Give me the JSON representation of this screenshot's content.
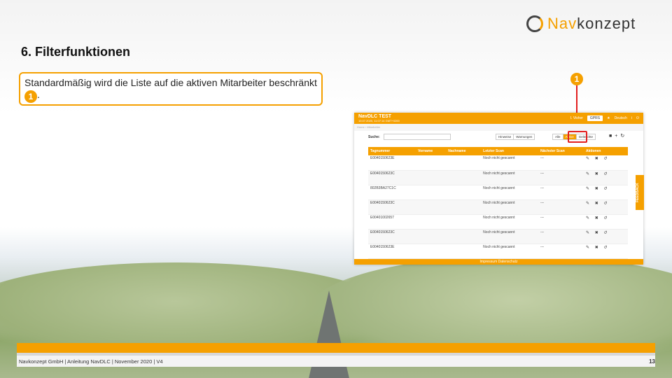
{
  "logo": {
    "part1": "Nav",
    "part2": "konzept"
  },
  "slide": {
    "title": "6. Filterfunktionen",
    "callout_text": "Standardmäßig wird die Liste auf die aktiven Mitarbeiter beschränkt",
    "callout_suffix": ".",
    "badge": "1"
  },
  "app": {
    "name": "NavDLC TEST",
    "timestamp": "10.07.2020, 11:07:14 GMT+0200",
    "user": "I. Visher",
    "gprs": "GPRS",
    "language": "Deutsch",
    "breadcrumb": "Home › Mitarbeiter",
    "search_label": "Suche:",
    "hint_buttons": [
      "Hinweise",
      "Warnungen"
    ],
    "filter_buttons": [
      "Alle",
      "Aktive",
      "Gelöschte"
    ],
    "columns": [
      "Tagnummer",
      "Vorname",
      "Nachname",
      "Letzter Scan",
      "Nächster Scan",
      "Aktionen"
    ],
    "rows": [
      {
        "tag": "E0040150623E",
        "scan": "Noch nicht gescannt",
        "next": "---"
      },
      {
        "tag": "E0040150623C",
        "scan": "Noch nicht gescannt",
        "next": "---"
      },
      {
        "tag": "802B3BA27C1C",
        "scan": "Noch nicht gescannt",
        "next": "---"
      },
      {
        "tag": "E0040150623C",
        "scan": "Noch nicht gescannt",
        "next": "---"
      },
      {
        "tag": "E00401002657",
        "scan": "Noch nicht gescannt",
        "next": "---"
      },
      {
        "tag": "E0040150623C",
        "scan": "Noch nicht gescannt",
        "next": "---"
      },
      {
        "tag": "E0040150623E",
        "scan": "Noch nicht gescannt",
        "next": "---"
      }
    ],
    "footer": "Impressum   Datenschutz",
    "feedback": "FEEDBACK"
  },
  "footer": {
    "text": "Navkonzept GmbH  |  Anleitung NavDLC  |  November 2020  |  V4",
    "page": "13"
  },
  "colors": {
    "accent": "#f5a000",
    "highlight": "#e21e1e"
  }
}
